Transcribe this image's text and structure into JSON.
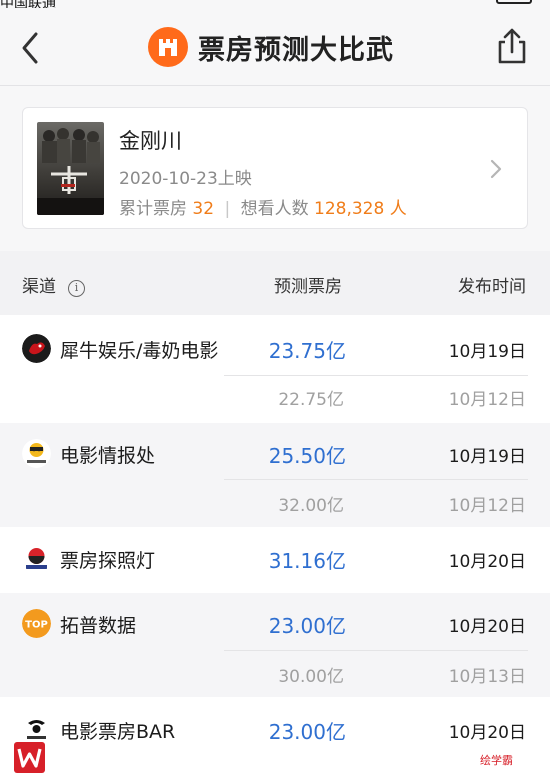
{
  "status_bar": {
    "left_text": "中国联通"
  },
  "header": {
    "title": "票房预测大比武",
    "back_icon": "chevron-left-icon",
    "share_icon": "share-icon",
    "logo_icon": "cinema-logo-icon"
  },
  "movie": {
    "title": "金刚川",
    "release": "2020-10-23上映",
    "box_label": "累计票房",
    "box_value": "32",
    "want_label": "想看人数",
    "want_value": "128,328 人"
  },
  "table": {
    "headers": {
      "channel": "渠道",
      "predict": "预测票房",
      "date": "发布时间"
    },
    "groups": [
      {
        "name": "犀牛娱乐/毒奶电影",
        "icon": "rhino-ent-logo-icon",
        "value": "23.75亿",
        "date": "10月19日",
        "history": [
          {
            "value": "22.75亿",
            "date": "10月12日"
          }
        ]
      },
      {
        "name": "电影情报处",
        "icon": "movie-intel-logo-icon",
        "value": "25.50亿",
        "date": "10月19日",
        "history": [
          {
            "value": "32.00亿",
            "date": "10月12日"
          }
        ]
      },
      {
        "name": "票房探照灯",
        "icon": "searchlight-logo-icon",
        "value": "31.16亿",
        "date": "10月20日",
        "history": []
      },
      {
        "name": "拓普数据",
        "icon": "top-data-logo-icon",
        "value": "23.00亿",
        "date": "10月20日",
        "history": [
          {
            "value": "30.00亿",
            "date": "10月13日"
          }
        ]
      },
      {
        "name": "电影票房BAR",
        "icon": "boxoffice-bar-logo-icon",
        "value": "23.00亿",
        "date": "10月20日",
        "history": []
      }
    ]
  },
  "watermark": {
    "right_text": "绘学霸"
  },
  "colors": {
    "accent_blue": "#2f6fd0",
    "orange": "#f07d1a",
    "brand": "#ff6a1a"
  }
}
